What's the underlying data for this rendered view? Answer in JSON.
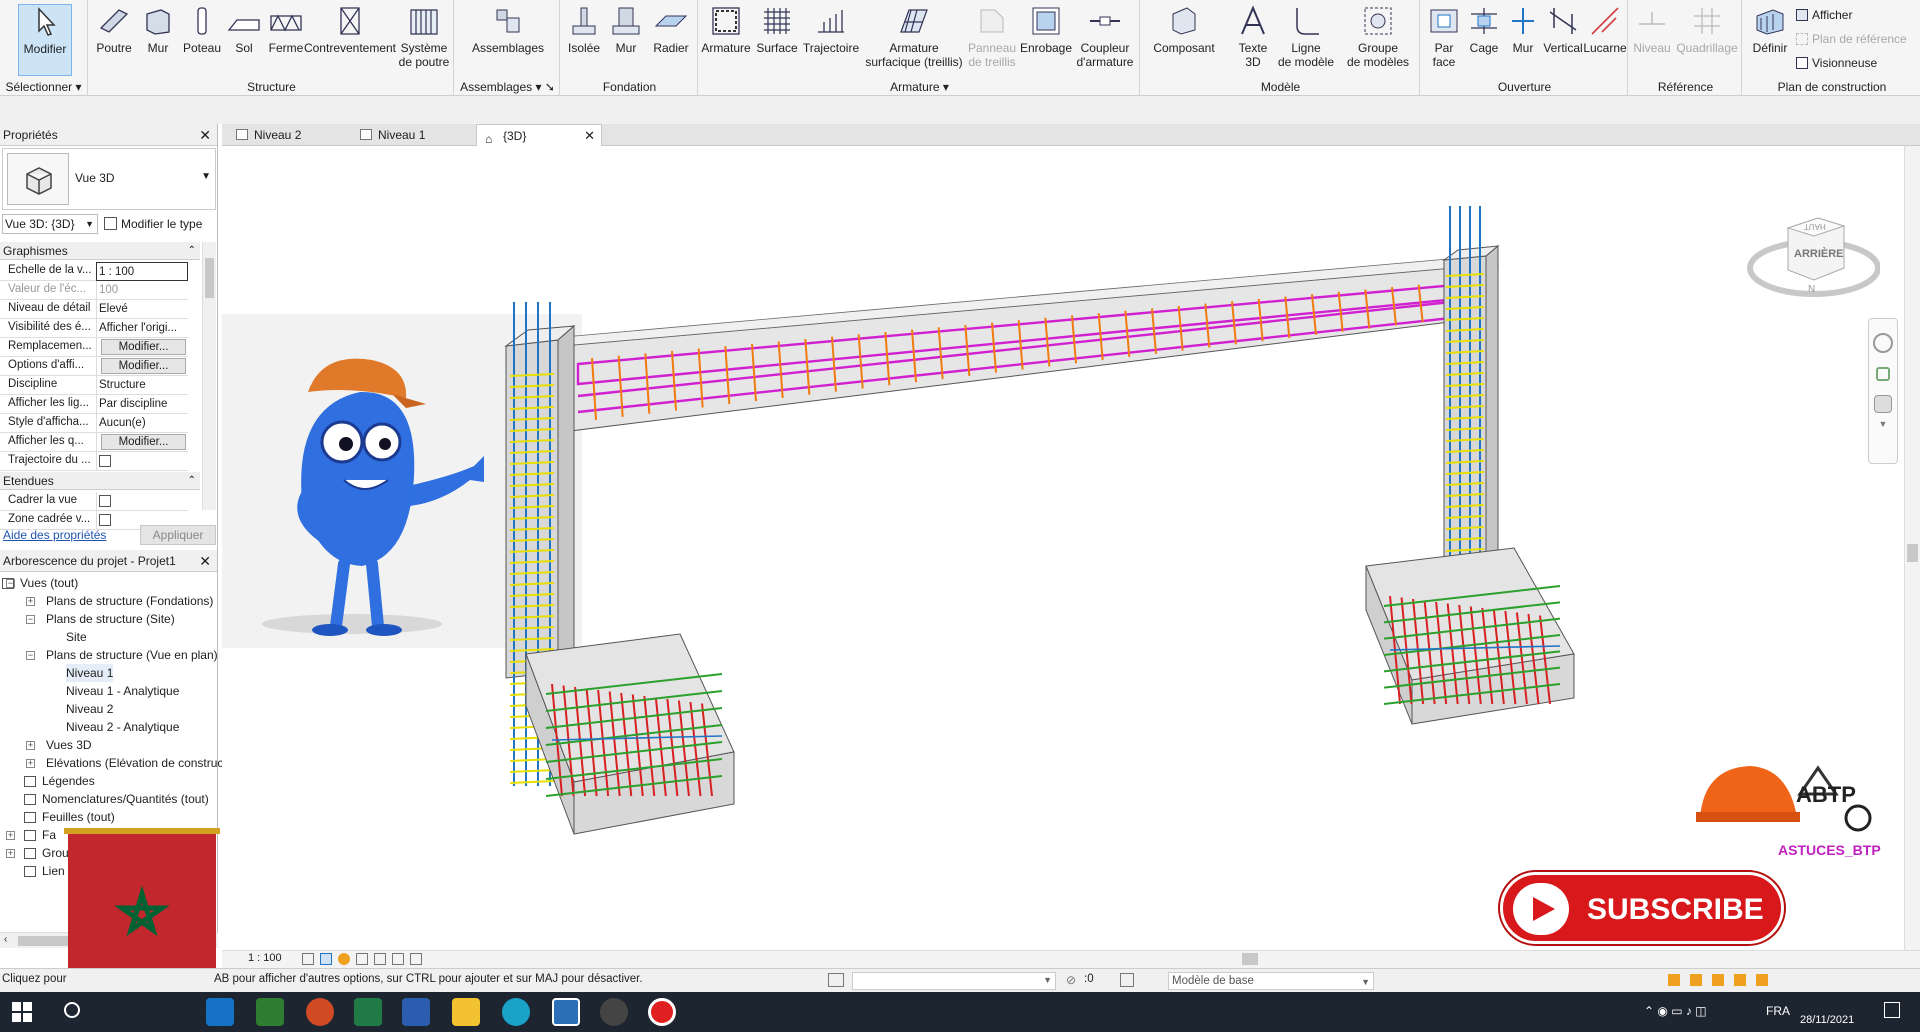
{
  "ribbon": {
    "panels": {
      "select": "Sélectionner",
      "structure": "Structure",
      "assemblages": "Assemblages",
      "fondation": "Fondation",
      "armature": "Armature",
      "modele": "Modèle",
      "ouverture": "Ouverture",
      "reference": "Référence",
      "plan": "Plan de construction"
    },
    "buttons": {
      "modifier": "Modifier",
      "poutre": "Poutre",
      "mur": "Mur",
      "poteau": "Poteau",
      "sol": "Sol",
      "ferme": "Ferme",
      "contreventement": "Contreventement",
      "systeme_1": "Système",
      "systeme_2": "de poutre",
      "assemblages": "Assemblages",
      "isolee": "Isolée",
      "mur_fond": "Mur",
      "radier": "Radier",
      "armature": "Armature",
      "surface": "Surface",
      "trajectoire": "Trajectoire",
      "arm_surf_1": "Armature",
      "arm_surf_2": "surfacique (treillis)",
      "panneau_1": "Panneau",
      "panneau_2": "de treillis",
      "enrobage": "Enrobage",
      "coupleur_1": "Coupleur",
      "coupleur_2": "d'armature",
      "composant": "Composant",
      "texte_1": "Texte",
      "texte_2": "3D",
      "ligne_1": "Ligne",
      "ligne_2": "de modèle",
      "groupe_1": "Groupe",
      "groupe_2": "de modèles",
      "par_face_1": "Par",
      "par_face_2": "face",
      "cage": "Cage",
      "mur_ouv": "Mur",
      "vertical": "Vertical",
      "lucarne": "Lucarne",
      "niveau": "Niveau",
      "quadrillage": "Quadrillage",
      "definir": "Définir",
      "afficher": "Afficher",
      "plan_ref": "Plan de référence",
      "visionneuse": "Visionneuse"
    }
  },
  "properties": {
    "title": "Propriétés",
    "type_name": "Vue 3D",
    "instance": "Vue 3D: {3D}",
    "edit_type": "Modifier le type",
    "group_graphics": "Graphismes",
    "group_extents": "Etendues",
    "rows": [
      {
        "k": "Echelle de la v...",
        "v": "1 : 100"
      },
      {
        "k": "Valeur de l'éc...",
        "v": "100"
      },
      {
        "k": "Niveau de détail",
        "v": "Elevé"
      },
      {
        "k": "Visibilité des é...",
        "v": "Afficher l'origi..."
      },
      {
        "k": "Remplacemen...",
        "v": "Modifier..."
      },
      {
        "k": "Options d'affi...",
        "v": "Modifier..."
      },
      {
        "k": "Discipline",
        "v": "Structure"
      },
      {
        "k": "Afficher les lig...",
        "v": "Par discipline"
      },
      {
        "k": "Style d'afficha...",
        "v": "Aucun(e)"
      },
      {
        "k": "Afficher les q...",
        "v": "Modifier..."
      },
      {
        "k": "Trajectoire du ...",
        "v": ""
      }
    ],
    "extent_rows": [
      {
        "k": "Cadrer la vue",
        "v": ""
      },
      {
        "k": "Zone cadrée v...",
        "v": ""
      }
    ],
    "help": "Aide des propriétés",
    "apply": "Appliquer"
  },
  "browser": {
    "title": "Arborescence du projet - Projet1",
    "items": [
      "Vues (tout)",
      "Plans de structure (Fondations)",
      "Plans de structure (Site)",
      "Site",
      "Plans de structure (Vue en plan)",
      "Niveau 1",
      "Niveau 1 - Analytique",
      "Niveau 2",
      "Niveau 2 - Analytique",
      "Vues 3D",
      "Elévations (Elévation de construc",
      "Légendes",
      "Nomenclatures/Quantités (tout)",
      "Feuilles (tout)",
      "Fa",
      "Grou",
      "Lien"
    ]
  },
  "tabs": [
    "Niveau 2",
    "Niveau 1",
    "{3D}"
  ],
  "viewcube": {
    "face": "ARRIÈRE",
    "top": "HAUT",
    "compass": "N"
  },
  "overlay": {
    "subscribe": "SUBSCRIBE",
    "brand": "ASTUCES_BTP",
    "logo": "ABTP"
  },
  "viewbar": {
    "scale": "1 : 100"
  },
  "status": {
    "left": "Cliquez pour",
    "hint": "AB pour afficher d'autres options, sur CTRL pour ajouter et sur MAJ pour désactiver.",
    "count": ":0",
    "model": "Modèle de base"
  },
  "taskbar": {
    "lang": "FRA",
    "date": "28/11/2021"
  },
  "colors": {
    "accent": "#1f75c4",
    "rebar_red": "#d82020",
    "rebar_green": "#2ca02c",
    "rebar_yellow": "#e8e000",
    "stirrup_orange": "#f07a10",
    "rebar_magenta": "#d020d0"
  }
}
